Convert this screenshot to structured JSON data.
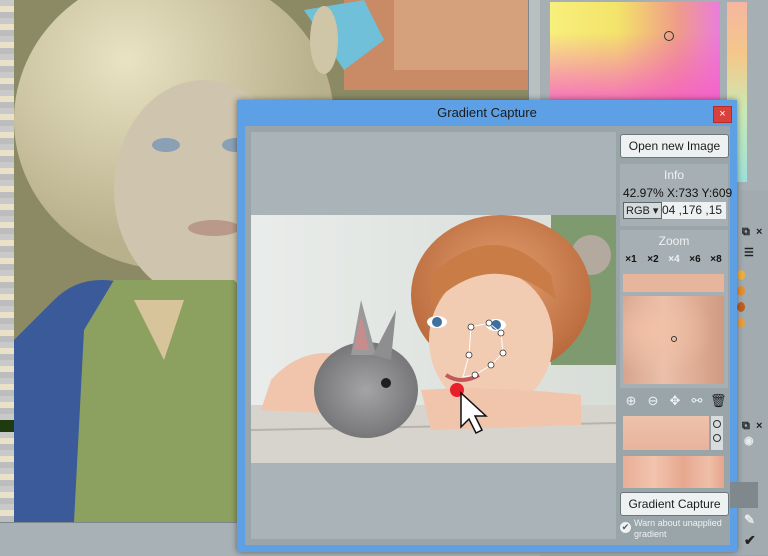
{
  "dialog": {
    "title": "Gradient Capture",
    "close_label": "×",
    "open_image_label": "Open new Image",
    "info": {
      "title": "Info",
      "readout": "42.97% X:733 Y:609",
      "mode": "RGB ▾",
      "rgb_values": "04 ,176 ,15"
    },
    "zoom": {
      "title": "Zoom",
      "levels": [
        "×1",
        "×2",
        "×4",
        "×6",
        "×8"
      ],
      "active_level": "×4"
    },
    "tools": [
      "add-point",
      "remove-point",
      "move",
      "reshape",
      "delete"
    ],
    "gradient_capture_label": "Gradient Capture",
    "warn_label": "Warn about unapplied gradient",
    "warn_checked": true
  },
  "colors": {
    "dialog_frame": "#5ea0e6",
    "close": "#d9423c",
    "marker": "#e8202a"
  }
}
